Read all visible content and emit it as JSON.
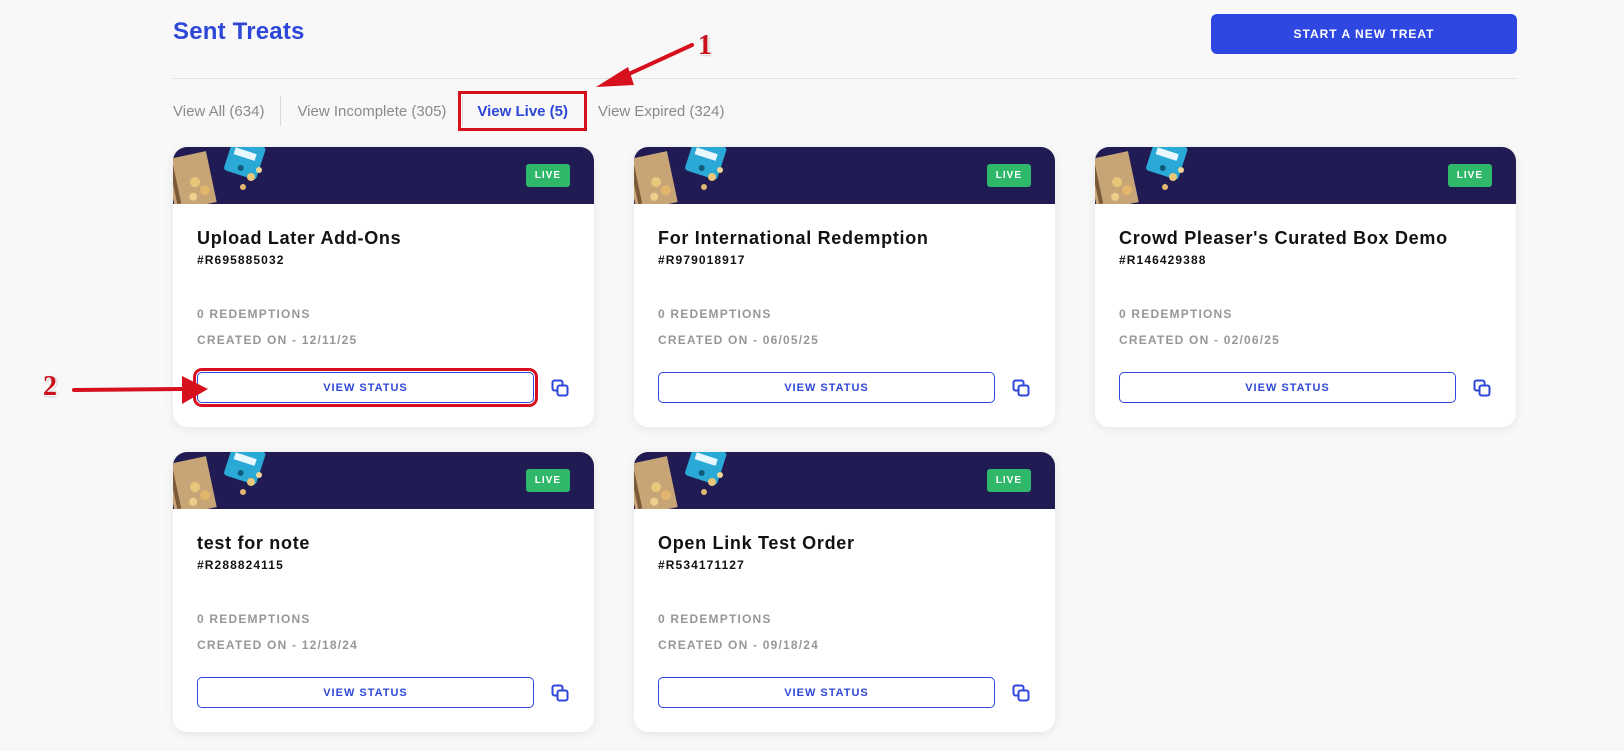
{
  "header": {
    "title": "Sent Treats",
    "start_button_label": "START A NEW TREAT"
  },
  "tabs": [
    {
      "label": "View All (634)",
      "active": false
    },
    {
      "label": "View Incomplete (305)",
      "active": false
    },
    {
      "label": "View Live (5)",
      "active": true
    },
    {
      "label": "View Expired (324)",
      "active": false
    }
  ],
  "cards": [
    {
      "status": "LIVE",
      "title": "Upload Later Add-Ons",
      "id": "#R695885032",
      "redemptions": "0 REDEMPTIONS",
      "created": "CREATED ON - 12/11/25",
      "button_label": "VIEW STATUS"
    },
    {
      "status": "LIVE",
      "title": "For International Redemption",
      "id": "#R979018917",
      "redemptions": "0 REDEMPTIONS",
      "created": "CREATED ON - 06/05/25",
      "button_label": "VIEW STATUS"
    },
    {
      "status": "LIVE",
      "title": "Crowd Pleaser's Curated Box Demo",
      "id": "#R146429388",
      "redemptions": "0 REDEMPTIONS",
      "created": "CREATED ON - 02/06/25",
      "button_label": "VIEW STATUS"
    },
    {
      "status": "LIVE",
      "title": "test for note",
      "id": "#R288824115",
      "redemptions": "0 REDEMPTIONS",
      "created": "CREATED ON - 12/18/24",
      "button_label": "VIEW STATUS"
    },
    {
      "status": "LIVE",
      "title": "Open Link Test Order",
      "id": "#R534171127",
      "redemptions": "0 REDEMPTIONS",
      "created": "CREATED ON - 09/18/24",
      "button_label": "VIEW STATUS"
    }
  ],
  "annotations": [
    {
      "label": "1"
    },
    {
      "label": "2"
    }
  ],
  "colors": {
    "accent": "#2e47e0",
    "banner": "#211b54",
    "live_badge": "#2fb86a",
    "annotation": "#d6101d"
  },
  "icons": {
    "copy": "copy-icon",
    "banner_art": "snack-bag-icon"
  }
}
